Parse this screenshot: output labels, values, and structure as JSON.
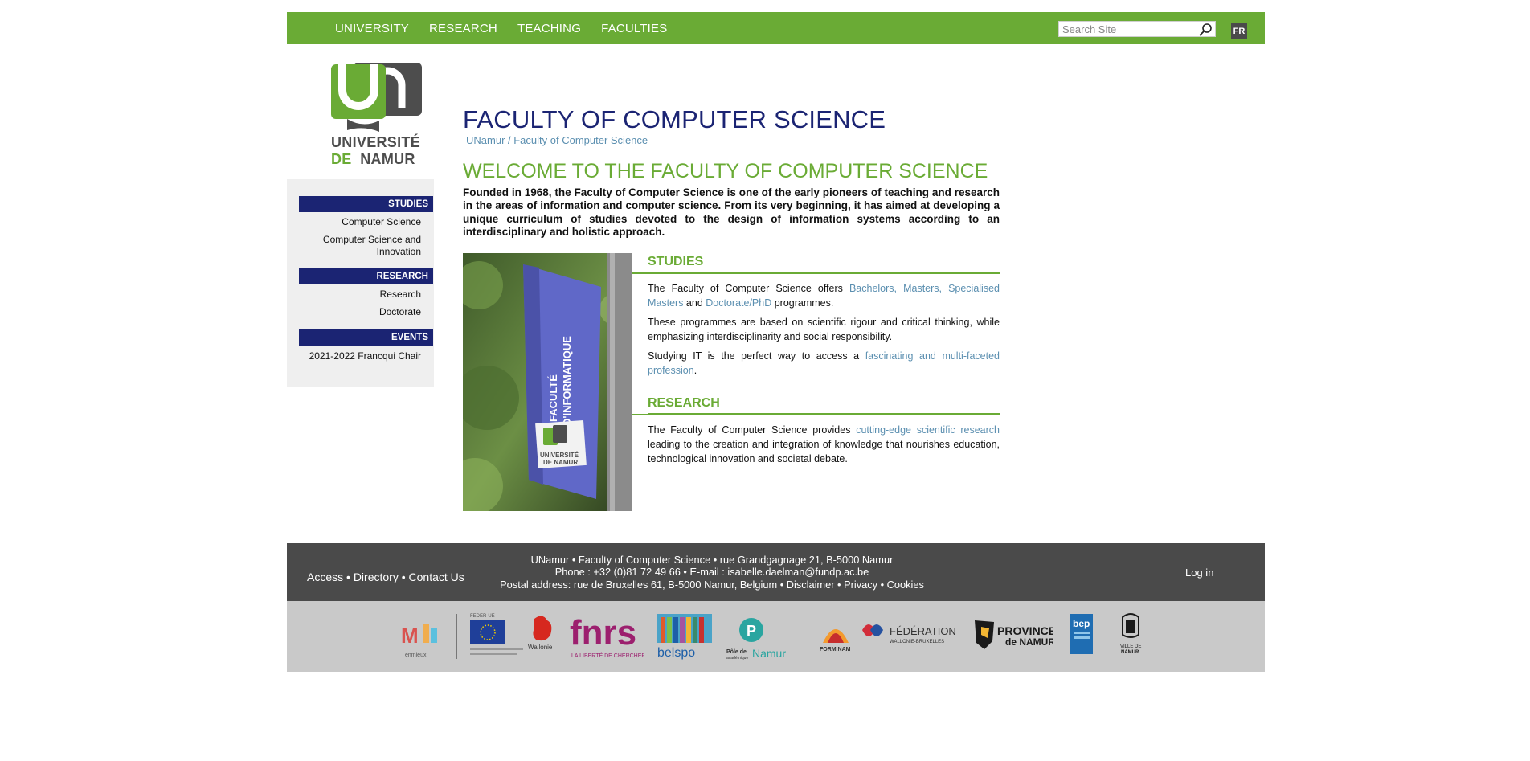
{
  "nav": {
    "items": [
      "UNIVERSITY",
      "RESEARCH",
      "TEACHING",
      "FACULTIES"
    ],
    "search_placeholder": "Search Site",
    "lang_label": "FR"
  },
  "logo": {
    "line1": "UNIVERSITÉ",
    "line2_de": "DE",
    "line2_namur": "NAMUR"
  },
  "sidebar": {
    "studies_heading": "STUDIES",
    "studies_items": [
      "Computer Science",
      "Computer Science and Innovation"
    ],
    "research_heading": "RESEARCH",
    "research_items": [
      "Research",
      "Doctorate"
    ],
    "events_heading": "EVENTS",
    "events_items": [
      "2021-2022 Francqui Chair"
    ]
  },
  "main": {
    "title": "FACULTY OF COMPUTER SCIENCE",
    "breadcrumb": "UNamur / Faculty of Computer Science",
    "welcome": "WELCOME TO THE FACULTY OF COMPUTER SCIENCE",
    "intro": "Founded in 1968, the Faculty of Computer Science is one of the early pioneers of teaching and research in the areas of information and computer science. From its very beginning, it has aimed at developing a unique curriculum of studies devoted to the design of information systems according to an interdisciplinary and holistic approach.",
    "banner_text1": "FACULTÉ",
    "banner_text2": "D'INFORMATIQUE",
    "banner_logo1": "UNIVERSITÉ",
    "banner_logo2": "DE NAMUR",
    "studies": {
      "heading": "STUDIES",
      "p1_a": "The Faculty of Computer Science offers ",
      "p1_link1": "Bachelors",
      "p1_sep1": ", ",
      "p1_link2": "Masters",
      "p1_sep2": ", ",
      "p1_link3": "Specialised Masters",
      "p1_b": " and ",
      "p1_link4": "Doctorate/PhD",
      "p1_c": " programmes.",
      "p2": "These programmes are based on scientific rigour and critical thinking, while emphasizing interdisciplinarity and social responsibility.",
      "p3_a": "Studying IT is the perfect way to access a ",
      "p3_link": "fascinating and multi-faceted profession",
      "p3_b": "."
    },
    "research": {
      "heading": "RESEARCH",
      "p1_a": "The Faculty of Computer Science provides ",
      "p1_link": "cutting-edge scientific research",
      "p1_b": " leading to the creation and integration of knowledge that nourishes education, technological innovation and societal debate."
    }
  },
  "footer": {
    "access": "Access",
    "directory": "Directory",
    "contact": "Contact Us",
    "sep": " • ",
    "address_line": "UNamur • Faculty of Computer Science • rue Grandgagnage 21, B-5000 Namur",
    "phone_line": "Phone : +32 (0)81 72 49 66 • E-mail : isabelle.daelman@fundp.ac.be",
    "postal": "Postal address: rue de Bruxelles 61, B-5000 Namur, Belgium",
    "disclaimer": "Disclaimer",
    "privacy": "Privacy",
    "cookies": "Cookies",
    "login": "Log in"
  },
  "partners": {
    "fnrs": "fnrs",
    "fnrs_tag": "LA LIBERTÉ DE CHERCHER",
    "belspo": "belspo",
    "pole": "Pôle de",
    "pole2": "académique",
    "pole3": "Namur",
    "federation": "FÉDÉRATION",
    "federation2": "WALLONIE-BRUXELLES",
    "province": "PROVINCE",
    "province2": "de NAMUR",
    "wallonie": "Wallonie",
    "ville": "VILLE DE",
    "ville2": "NAMUR",
    "bep": "bep",
    "formanam": "FORM NAM",
    "enmieux": "enmieux",
    "europe": "FEDER-UE"
  },
  "colors": {
    "green": "#6aab35",
    "navy": "#1b2473",
    "link": "#5b8fb0",
    "footer": "#4a4a4a"
  }
}
